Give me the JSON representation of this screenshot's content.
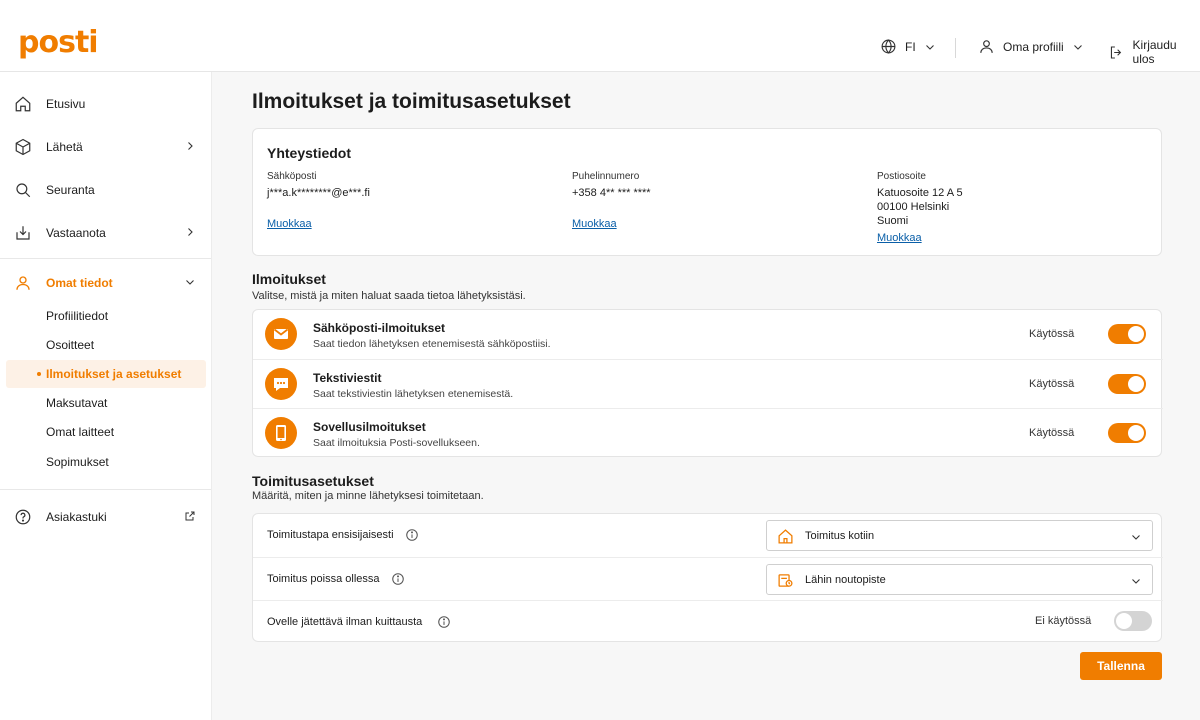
{
  "brand": {
    "logo_text": "posti",
    "accent": "#f07d00",
    "link": "#0a5fa8"
  },
  "header": {
    "language": {
      "label": "FI",
      "icon": "globe-icon"
    },
    "profile": {
      "label": "Oma profiili",
      "icon": "user-icon"
    },
    "logout": {
      "label": "Kirjaudu ulos",
      "icon": "logout-icon"
    }
  },
  "sidebar": {
    "items": [
      {
        "label": "Etusivu",
        "icon": "home-icon"
      },
      {
        "label": "Lähetä",
        "icon": "package-icon"
      },
      {
        "label": "Seuranta",
        "icon": "search-icon"
      },
      {
        "label": "Vastaanota",
        "icon": "receive-icon"
      },
      {
        "label": "Omat tiedot",
        "icon": "user-icon"
      }
    ],
    "subitems": [
      {
        "label": "Profiilitiedot"
      },
      {
        "label": "Osoitteet"
      },
      {
        "label": "Ilmoitukset ja asetukset",
        "active": true
      },
      {
        "label": "Maksutavat"
      },
      {
        "label": "Omat laitteet"
      },
      {
        "label": "Sopimukset"
      }
    ],
    "support": {
      "label": "Asiakastuki",
      "icon": "help-icon",
      "external_icon": "external-link-icon"
    }
  },
  "main": {
    "title": "Ilmoitukset ja toimitusasetukset",
    "contact": {
      "title": "Yhteystiedot",
      "email": {
        "label": "Sähköposti",
        "value": "j***a.k********@e***.fi",
        "edit": "Muokkaa"
      },
      "phone": {
        "label": "Puhelinnumero",
        "value": "+358 4** *** ****",
        "edit": "Muokkaa"
      },
      "address": {
        "label": "Postiosoite",
        "line1": "Katuosoite 12 A 5",
        "line2": "00100 Helsinki",
        "line3": "Suomi",
        "edit": "Muokkaa"
      }
    },
    "notifications": {
      "title": "Ilmoitukset",
      "description": "Valitse, mistä ja miten haluat saada tietoa lähetyksistäsi.",
      "items": [
        {
          "title": "Sähköposti-ilmoitukset",
          "desc": "Saat tiedon lähetyksen etenemisestä sähköpostiisi.",
          "status": "Käytössä",
          "enabled": true,
          "icon": "mail-icon"
        },
        {
          "title": "Tekstiviestit",
          "desc": "Saat tekstiviestin lähetyksen etenemisestä.",
          "status": "Käytössä",
          "enabled": true,
          "icon": "chat-icon"
        },
        {
          "title": "Sovellusilmoitukset",
          "desc": "Saat ilmoituksia Posti-sovellukseen.",
          "status": "Käytössä",
          "enabled": true,
          "icon": "phone-icon"
        }
      ]
    },
    "delivery": {
      "title": "Toimitusasetukset",
      "description": "Määritä, miten ja minne lähetyksesi toimitetaan.",
      "rows": [
        {
          "label": "Toimitustapa ensisijaisesti",
          "value": "Toimitus kotiin",
          "icon": "house-icon"
        },
        {
          "label": "Toimitus poissa ollessa",
          "value": "Lähin noutopiste",
          "icon": "pickup-point-icon"
        },
        {
          "label": "Ovelle jätettävä ilman kuittausta",
          "status": "Ei käytössä",
          "enabled": false
        }
      ]
    },
    "save_label": "Tallenna"
  }
}
